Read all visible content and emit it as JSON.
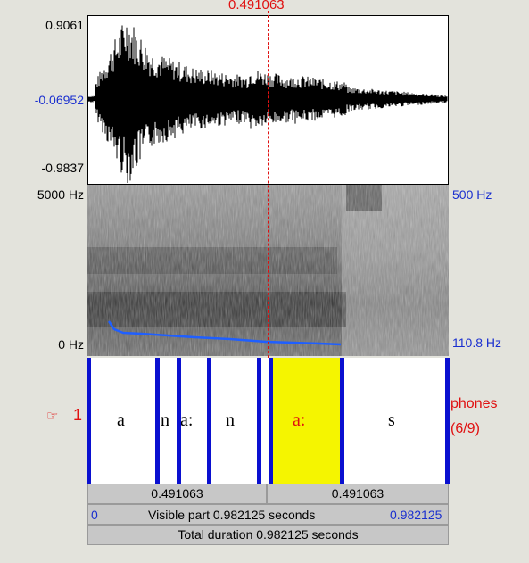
{
  "cursor": {
    "time_label": "0.491063"
  },
  "waveform": {
    "max_label": "0.9061",
    "mid_label": "-0.06952",
    "min_label": "-0.9837"
  },
  "spectrogram": {
    "freq_top_label": "5000 Hz",
    "freq_bottom_label": "0 Hz",
    "pitch_top_label": "500 Hz",
    "pitch_bottom_label": "110.8 Hz"
  },
  "tier": {
    "number": "1",
    "name": "phones",
    "count": "(6/9)",
    "intervals": [
      {
        "text": "a",
        "selected": false
      },
      {
        "text": "n",
        "selected": false
      },
      {
        "text": "a:",
        "selected": false
      },
      {
        "text": "n",
        "selected": false
      },
      {
        "text": "",
        "selected": false
      },
      {
        "text": "a:",
        "selected": true
      },
      {
        "text": "s",
        "selected": false
      }
    ]
  },
  "timebar": {
    "left_segment": "0.491063",
    "right_segment": "0.491063",
    "visible_start": "0",
    "visible_label": "Visible part 0.982125 seconds",
    "visible_end": "0.982125",
    "total_label": "Total duration 0.982125 seconds"
  },
  "colors": {
    "accent_red": "#e01010",
    "boundary_blue": "#0a10d0",
    "pitch_blue": "#1f5fff",
    "selection_yellow": "#f5f500"
  }
}
